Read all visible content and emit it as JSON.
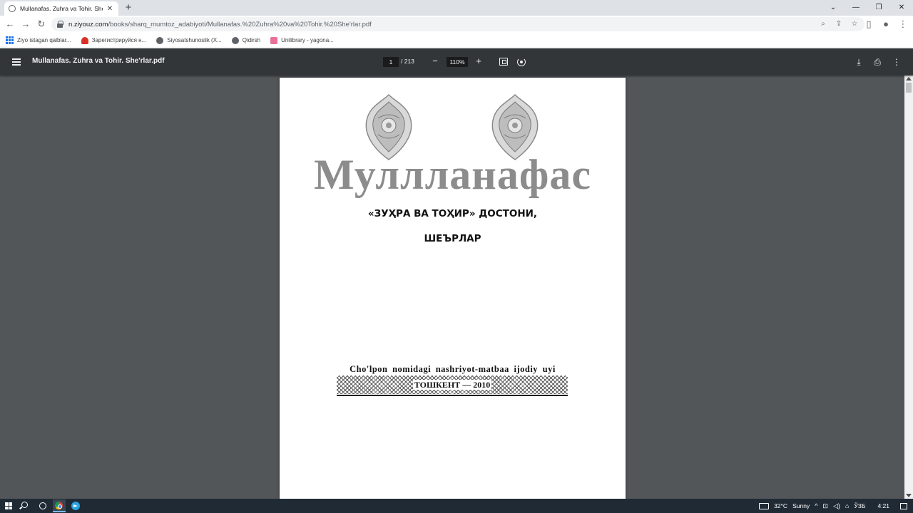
{
  "browser": {
    "tab_title": "Mullanafas. Zuhra va Tohir. She'rl",
    "tab_close": "✕",
    "new_tab": "+",
    "url_host": "n.ziyouz.com",
    "url_path": "/books/sharq_mumtoz_adabiyoti/Mullanafas.%20Zuhra%20va%20Tohir.%20She'rlar.pdf",
    "bookmarks": [
      {
        "label": "Ziyo istagan qalblar...",
        "icon": "apps-grid-icon"
      },
      {
        "label": "Зарегистрируйся н...",
        "icon": "heart-icon"
      },
      {
        "label": "Siyosatshunoslik (X...",
        "icon": "globe-icon"
      },
      {
        "label": "Qidirsh",
        "icon": "globe-icon"
      },
      {
        "label": "Unilibrary - yagona...",
        "icon": "book-icon"
      }
    ]
  },
  "pdf": {
    "title": "Mullanafas. Zuhra va Tohir. She'rlar.pdf",
    "current_page": "1",
    "page_total": "/ 213",
    "zoom": "110%",
    "zoom_minus": "−",
    "zoom_plus": "+"
  },
  "document": {
    "author": "Муллланафас",
    "subtitle": "«ЗУҲРА ВА ТОҲИР» ДОСТОНИ,",
    "subtitle2": "ШЕЪРЛАР",
    "publisher": "Cho'lpon nomidagi nashriyot-matbaa ijodiy uyi",
    "city_year": "ТОШКЕНТ — 2010"
  },
  "taskbar": {
    "temperature": "32°C",
    "weather": "Sunny",
    "language": "ЎЗБ",
    "time": "4:21"
  },
  "colors": {
    "title_gray": "#8c8c8c",
    "pdf_toolbar": "#323639",
    "pdf_bg": "#525659",
    "taskbar": "#1f2a35"
  }
}
